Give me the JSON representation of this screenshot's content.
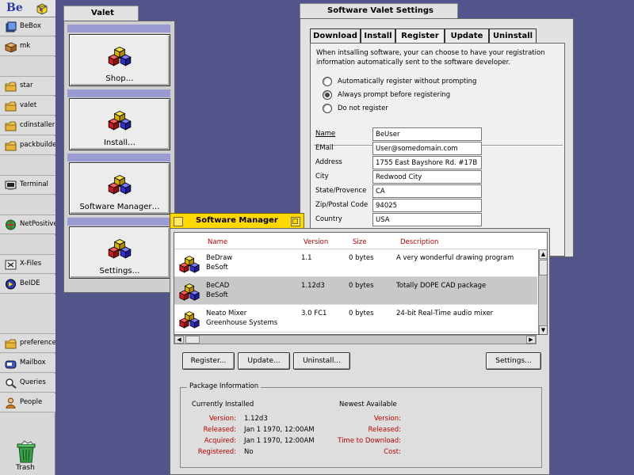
{
  "deskbar": {
    "logo": "Be",
    "items": [
      {
        "label": "BeBox",
        "icon": "bebox-icon"
      },
      {
        "label": "mk",
        "icon": "package-icon"
      },
      {
        "label": "star",
        "icon": "folder-icon"
      },
      {
        "label": "valet",
        "icon": "folder-icon"
      },
      {
        "label": "cdinstaller",
        "icon": "folder-icon"
      },
      {
        "label": "packbuilder",
        "icon": "folder-icon"
      },
      {
        "label": "Terminal",
        "icon": "terminal-icon"
      },
      {
        "label": "NetPositive",
        "icon": "globe-icon"
      },
      {
        "label": "X-Files",
        "icon": "xfiles-icon"
      },
      {
        "label": "BeIDE",
        "icon": "beide-icon"
      },
      {
        "label": "preferences",
        "icon": "folder-icon"
      },
      {
        "label": "Mailbox",
        "icon": "mailbox-icon"
      },
      {
        "label": "Queries",
        "icon": "queries-icon"
      },
      {
        "label": "People",
        "icon": "people-icon"
      }
    ],
    "trash_label": "Trash"
  },
  "valet": {
    "title": "Valet",
    "buttons": [
      "Shop…",
      "Install…",
      "Software Manager…",
      "Settings…"
    ]
  },
  "settings": {
    "title": "Software Valet Settings",
    "tabs": [
      "Download",
      "Install",
      "Register",
      "Update",
      "Uninstall"
    ],
    "active_tab": "Register",
    "intro": "When intsalling software, your can choose to have your registration information automatically sent to the software developer.",
    "options": [
      {
        "label": "Automatically register without prompting",
        "selected": false
      },
      {
        "label": "Always prompt before registering",
        "selected": true
      },
      {
        "label": "Do not register",
        "selected": false
      }
    ],
    "fields": [
      {
        "label": "Name",
        "value": "BeUser"
      },
      {
        "label": "EMail",
        "value": "User@somedomain.com"
      },
      {
        "label": "Address",
        "value": "1755 East Bayshore Rd. #17B"
      },
      {
        "label": "City",
        "value": "Redwood City"
      },
      {
        "label": "State/Provence",
        "value": "CA"
      },
      {
        "label": "Zip/Postal Code",
        "value": "94025"
      },
      {
        "label": "Country",
        "value": "USA"
      }
    ]
  },
  "manager": {
    "title": "Software Manager",
    "columns": [
      "Name",
      "Version",
      "Size",
      "Description"
    ],
    "rows": [
      {
        "name": "BeDraw",
        "vendor": "BeSoft",
        "version": "1.1",
        "size": "0 bytes",
        "description": "A very wonderful drawing program"
      },
      {
        "name": "BeCAD",
        "vendor": "BeSoft",
        "version": "1.12d3",
        "size": "0 bytes",
        "description": "Totally DOPE CAD package"
      },
      {
        "name": "Neato Mixer",
        "vendor": "Greenhouse Systems",
        "version": "3.0 FC1",
        "size": "0 bytes",
        "description": "24-bit Real-Time audio mixer"
      }
    ],
    "buttons": [
      "Register...",
      "Update...",
      "Uninstall...",
      "Settings..."
    ],
    "package_info": {
      "legend": "Package Information",
      "installed_header": "Currently Installed",
      "newest_header": "Newest Available",
      "installed": [
        {
          "label": "Version:",
          "value": "1.12d3"
        },
        {
          "label": "Released:",
          "value": "Jan 1 1970, 12:00AM"
        },
        {
          "label": "Acquired:",
          "value": "Jan 1 1970, 12:00AM"
        },
        {
          "label": "Registered:",
          "value": "No"
        }
      ],
      "newest": [
        {
          "label": "Version:",
          "value": ""
        },
        {
          "label": "Released:",
          "value": ""
        },
        {
          "label": "Time to Download:",
          "value": ""
        },
        {
          "label": "Cost:",
          "value": ""
        }
      ]
    }
  }
}
